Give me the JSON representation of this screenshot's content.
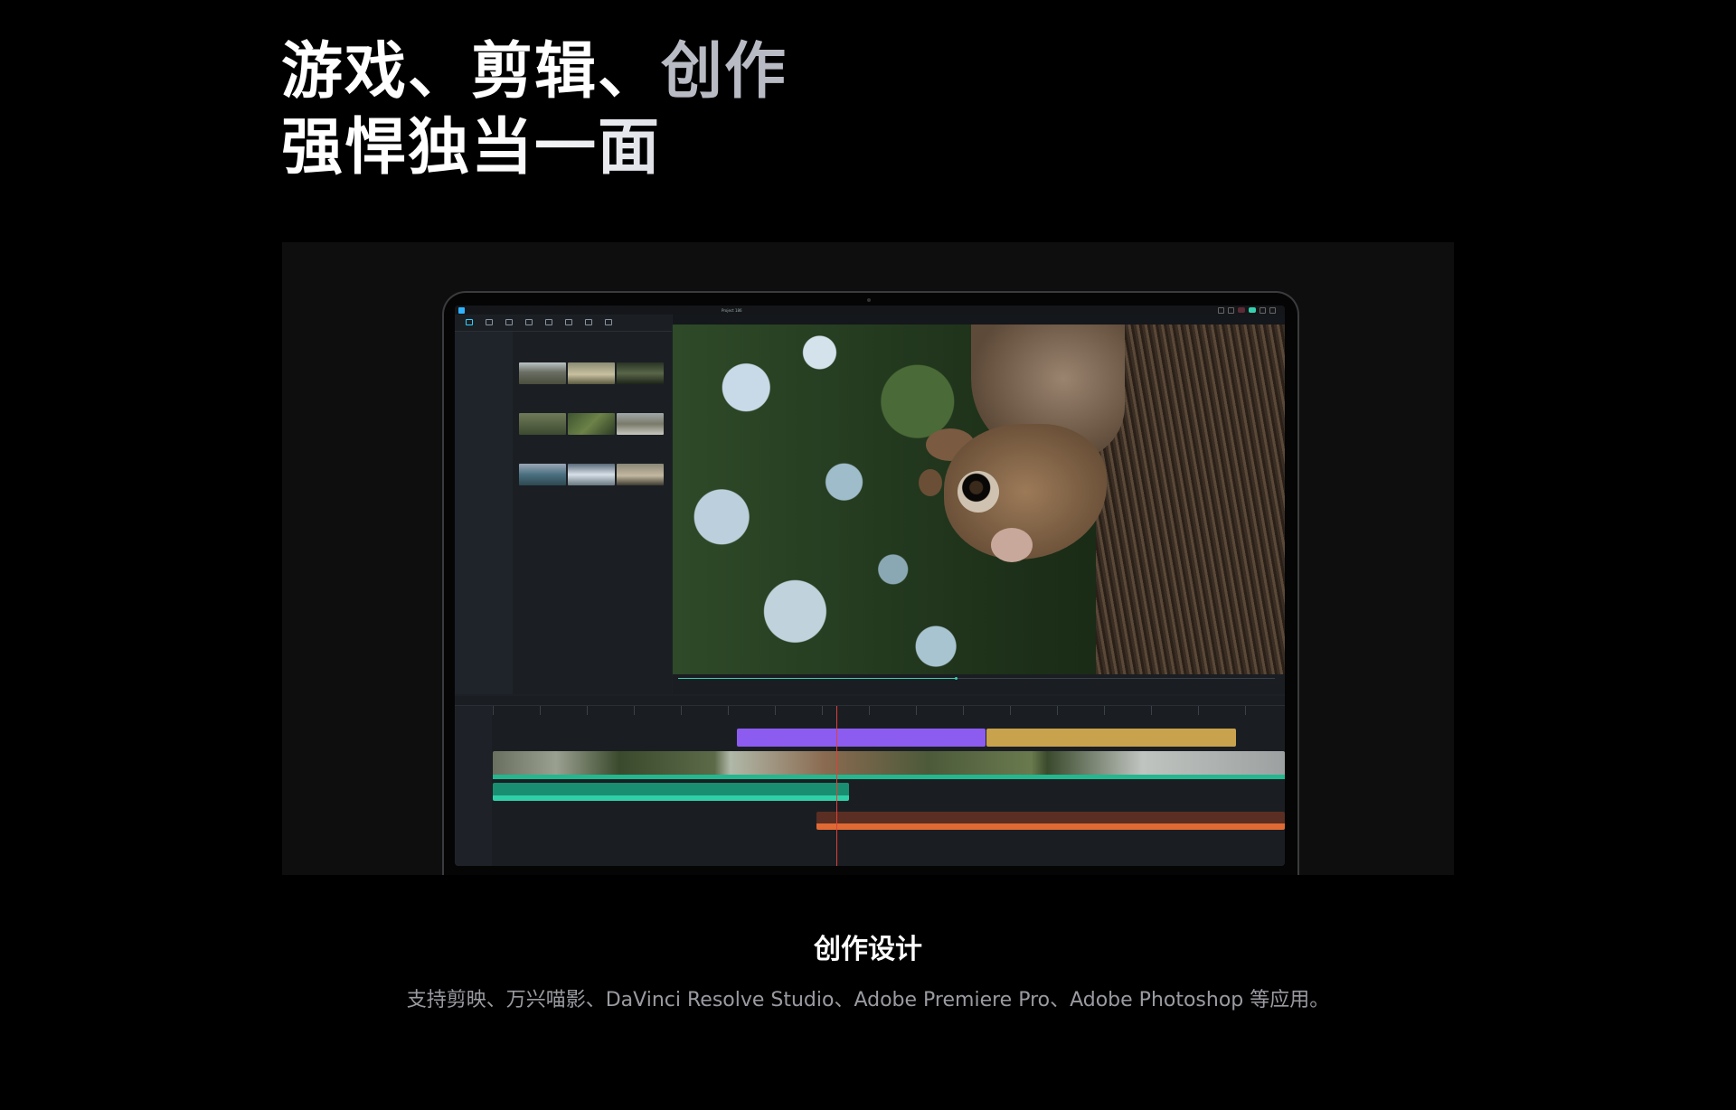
{
  "headline": {
    "line1_white": "游戏、剪辑、",
    "line1_gray": "创作",
    "line2": "强悍独当一面"
  },
  "section": {
    "title": "创作设计",
    "description": "支持剪映、万兴喵影、DaVinci Resolve Studio、Adobe Premiere Pro、Adobe Photoshop 等应用。"
  },
  "app": {
    "project_title": "Project 186"
  }
}
